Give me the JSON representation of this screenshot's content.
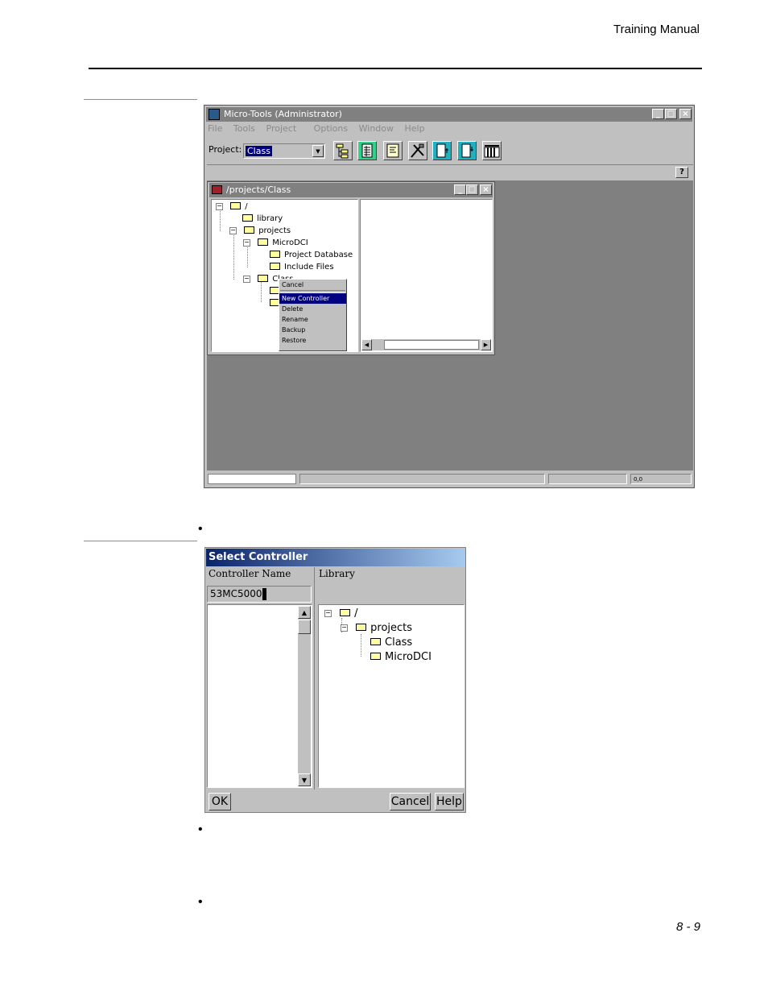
{
  "header": {
    "title": "Training Manual"
  },
  "footer": {
    "page_number": "8 - 9"
  },
  "main_window": {
    "title": "Micro-Tools (Administrator)",
    "menu": [
      "File",
      "Tools",
      "Project",
      "Options",
      "Window",
      "Help"
    ],
    "project_label": "Project:",
    "project_value": "Class",
    "help_button": "?",
    "status_zoom": "0,0",
    "toolbar_icons": [
      "tree-icon",
      "grid-icon",
      "document-icon",
      "tools-icon",
      "download-icon",
      "upload-icon",
      "blocks-icon"
    ]
  },
  "child_window": {
    "title": "/projects/Class",
    "tree": [
      {
        "label": "/",
        "level": 0,
        "expander": "−"
      },
      {
        "label": "library",
        "level": 1,
        "expander": ""
      },
      {
        "label": "projects",
        "level": 1,
        "expander": "−"
      },
      {
        "label": "MicroDCI",
        "level": 2,
        "expander": "−"
      },
      {
        "label": "Project Database",
        "level": 3,
        "expander": ""
      },
      {
        "label": "Include Files",
        "level": 3,
        "expander": ""
      },
      {
        "label": "Class",
        "level": 2,
        "expander": "−"
      }
    ],
    "context_menu": {
      "items": [
        "Cancel",
        "New Controller",
        "Delete",
        "Rename",
        "Backup",
        "Restore"
      ],
      "selected": "New Controller"
    }
  },
  "select_controller": {
    "title": "Select Controller",
    "name_label": "Controller Name",
    "library_label": "Library",
    "name_value": "53MC5000",
    "library_tree": [
      {
        "label": "/",
        "level": 0,
        "expander": "−"
      },
      {
        "label": "projects",
        "level": 1,
        "expander": "−"
      },
      {
        "label": "Class",
        "level": 2,
        "expander": ""
      },
      {
        "label": "MicroDCI",
        "level": 2,
        "expander": ""
      }
    ],
    "ok_label": "OK",
    "cancel_label": "Cancel",
    "help_label": "Help"
  },
  "bullets": [
    "•",
    "•",
    "•"
  ]
}
